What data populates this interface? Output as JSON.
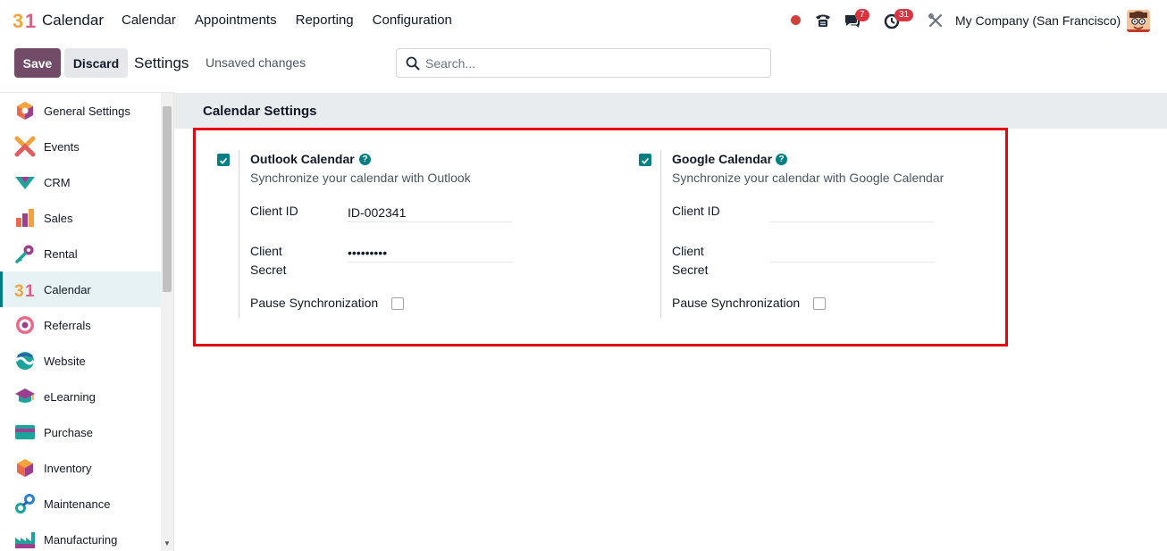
{
  "app": {
    "logo_text": "31",
    "name": "Calendar"
  },
  "nav": {
    "items": [
      "Calendar",
      "Appointments",
      "Reporting",
      "Configuration"
    ]
  },
  "systray": {
    "messages_count": "7",
    "activities_count": "31",
    "company": "My Company (San Francisco)"
  },
  "control_panel": {
    "save_label": "Save",
    "discard_label": "Discard",
    "title": "Settings",
    "unsaved": "Unsaved changes",
    "search_placeholder": "Search..."
  },
  "sidebar": {
    "items": [
      {
        "label": "General Settings",
        "icon": "general-settings-icon",
        "active": false
      },
      {
        "label": "Events",
        "icon": "events-icon",
        "active": false
      },
      {
        "label": "CRM",
        "icon": "crm-icon",
        "active": false
      },
      {
        "label": "Sales",
        "icon": "sales-icon",
        "active": false
      },
      {
        "label": "Rental",
        "icon": "rental-icon",
        "active": false
      },
      {
        "label": "Calendar",
        "icon": "calendar-icon",
        "active": true
      },
      {
        "label": "Referrals",
        "icon": "referrals-icon",
        "active": false
      },
      {
        "label": "Website",
        "icon": "website-icon",
        "active": false
      },
      {
        "label": "eLearning",
        "icon": "elearning-icon",
        "active": false
      },
      {
        "label": "Purchase",
        "icon": "purchase-icon",
        "active": false
      },
      {
        "label": "Inventory",
        "icon": "inventory-icon",
        "active": false
      },
      {
        "label": "Maintenance",
        "icon": "maintenance-icon",
        "active": false
      },
      {
        "label": "Manufacturing",
        "icon": "manufacturing-icon",
        "active": false
      }
    ]
  },
  "section": {
    "title": "Calendar Settings"
  },
  "outlook": {
    "title": "Outlook Calendar",
    "description": "Synchronize your calendar with Outlook",
    "enabled": true,
    "client_id_label": "Client ID",
    "client_id_value": "ID-002341",
    "client_secret_label_1": "Client",
    "client_secret_label_2": "Secret",
    "client_secret_value": "•••••••••",
    "pause_label": "Pause Synchronization",
    "pause_checked": false
  },
  "google": {
    "title": "Google Calendar",
    "description": "Synchronize your calendar with Google Calendar",
    "enabled": true,
    "client_id_label": "Client ID",
    "client_id_value": "",
    "client_secret_label_1": "Client",
    "client_secret_label_2": "Secret",
    "client_secret_value": "",
    "pause_label": "Pause Synchronization",
    "pause_checked": false
  },
  "colors": {
    "brand": "#714b67",
    "accent": "#017e84",
    "highlight": "#e30613",
    "notification": "#d9343f"
  }
}
